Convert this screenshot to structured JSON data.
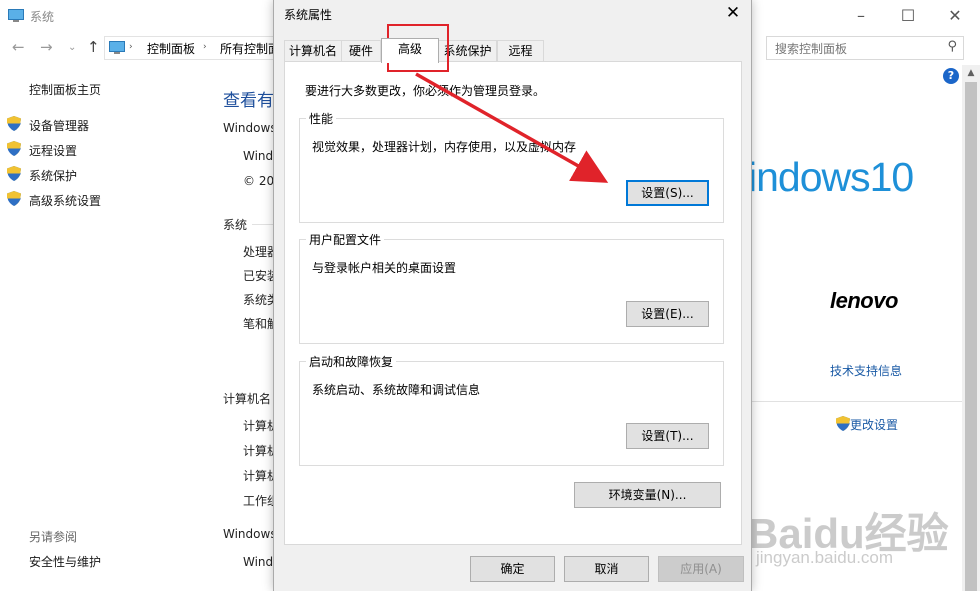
{
  "background_window": {
    "title": "系统",
    "breadcrumb": [
      "控制面板",
      "所有控制面"
    ],
    "search_placeholder": "搜索控制面板",
    "left_nav": {
      "home": "控制面板主页",
      "items": [
        "设备管理器",
        "远程设置",
        "系统保护",
        "高级系统设置"
      ],
      "see_also_title": "另请参阅",
      "see_also_items": [
        "安全性与维护"
      ]
    },
    "heading": "查看有",
    "sections": [
      {
        "title": "Windows",
        "rows": [
          "Wind",
          "© 20"
        ]
      },
      {
        "title": "系统",
        "rows": [
          "处理器",
          "已安装",
          "系统类",
          "笔和触"
        ]
      },
      {
        "title": "计算机名",
        "rows": [
          "计算机",
          "计算机",
          "计算机",
          "工作组"
        ]
      },
      {
        "title": "Windows",
        "rows": [
          "Wind"
        ]
      }
    ],
    "right_panel": {
      "windows_logo": "indows10",
      "oem_logo": "lenovo",
      "support_link": "技术支持信息",
      "change_settings_link": "更改设置"
    },
    "watermark": {
      "text": "Baidu经验",
      "url": "jingyan.baidu.com"
    }
  },
  "dialog": {
    "title": "系统属性",
    "tabs": [
      "计算机名",
      "硬件",
      "高级",
      "系统保护",
      "远程"
    ],
    "active_tab": "高级",
    "admin_note": "要进行大多数更改，你必须作为管理员登录。",
    "groups": [
      {
        "label": "性能",
        "description": "视觉效果，处理器计划，内存使用，以及虚拟内存",
        "button": "设置(S)..."
      },
      {
        "label": "用户配置文件",
        "description": "与登录帐户相关的桌面设置",
        "button": "设置(E)..."
      },
      {
        "label": "启动和故障恢复",
        "description": "系统启动、系统故障和调试信息",
        "button": "设置(T)..."
      }
    ],
    "env_button": "环境变量(N)...",
    "ok_button": "确定",
    "cancel_button": "取消",
    "apply_button": "应用(A)"
  },
  "colors": {
    "accent_blue": "#1e4f9c",
    "windows_blue": "#1e90d8",
    "annotation_red": "#e0232a",
    "focus_blue": "#0078d7"
  }
}
